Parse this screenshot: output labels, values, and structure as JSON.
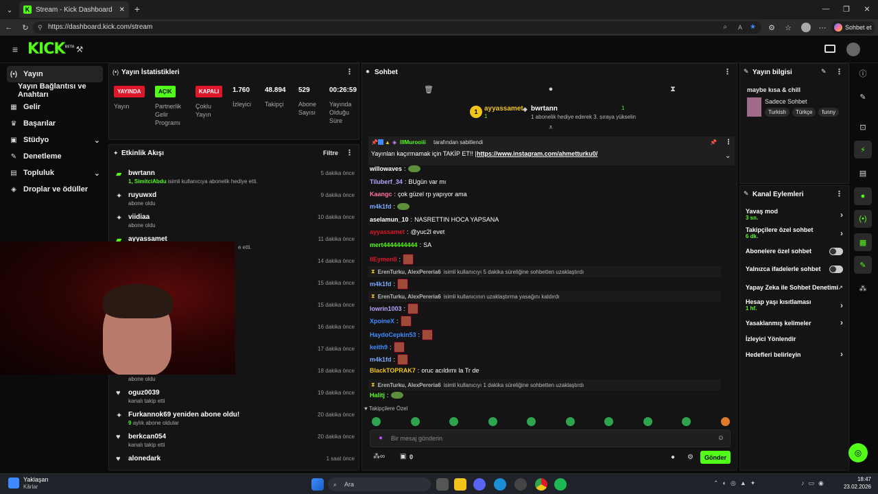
{
  "browser": {
    "tab_title": "Stream - Kick Dashboard",
    "url": "https://dashboard.kick.com/stream",
    "profile_button": "Sohbet et"
  },
  "brand": {
    "logo": "KICK",
    "beta": "BETA",
    "accent": "#53fc18"
  },
  "sidebar": {
    "items": [
      {
        "label": "Yayın",
        "icon": "broadcast-icon"
      },
      {
        "label": "Yayın Bağlantısı ve Anahtarı"
      },
      {
        "label": "Gelir",
        "icon": "revenue-icon"
      },
      {
        "label": "Başarılar",
        "icon": "trophy-icon"
      },
      {
        "label": "Stüdyo",
        "icon": "studio-icon"
      },
      {
        "label": "Denetleme",
        "icon": "wrench-icon"
      },
      {
        "label": "Topluluk",
        "icon": "community-icon"
      },
      {
        "label": "Droplar ve ödüller",
        "icon": "gift-icon"
      }
    ]
  },
  "stats": {
    "title": "Yayın İstatistikleri",
    "badges": [
      {
        "text": "YAYINDA",
        "label": "Yayın",
        "color": "#e0162b"
      },
      {
        "text": "AÇIK",
        "label": "Partnerlik Gelir Programı",
        "color": "#53fc18"
      },
      {
        "text": "KAPALI",
        "label": "Çoklu Yayın",
        "color": "#e0162b"
      }
    ],
    "values": [
      {
        "value": "1.760",
        "label": "İzleyici"
      },
      {
        "value": "48.894",
        "label": "Takipçi"
      },
      {
        "value": "529",
        "label": "Abone Sayısı"
      },
      {
        "value": "00:26:59",
        "label": "Yayında Olduğu Süre"
      }
    ]
  },
  "activity": {
    "title": "Etkinlik Akışı",
    "filter": "Filtre",
    "items": [
      {
        "name": "bwrtann",
        "sub_count": "1,",
        "sub_user": "SimitciAbdu",
        "sub": "isimli kullanıcıya abonelik hediye etti.",
        "time": "5 dakika önce",
        "icon": "gift-icon"
      },
      {
        "name": "ruyuwxd",
        "sub": "abone oldu",
        "time": "9 dakika önce",
        "icon": "sparkle-icon"
      },
      {
        "name": "viidiaa",
        "sub": "abone oldu",
        "time": "10 dakika önce",
        "icon": "sparkle-icon"
      },
      {
        "name": "ayyassamet",
        "sub": "e etti.",
        "time": "11 dakika önce",
        "icon": "gift-icon"
      },
      {
        "name": "",
        "sub": "",
        "time": "14 dakika önce"
      },
      {
        "name": "",
        "sub": "",
        "time": "15 dakika önce"
      },
      {
        "name": "",
        "sub": "",
        "time": "15 dakika önce"
      },
      {
        "name": "",
        "sub": "",
        "time": "16 dakika önce"
      },
      {
        "name": "",
        "sub": "",
        "time": "17 dakika önce"
      },
      {
        "name": "",
        "sub": "abone oldu",
        "time": "18 dakika önce"
      },
      {
        "name": "oguz0039",
        "sub": "kanalı takip etti",
        "time": "19 dakika önce",
        "icon": "heart-icon"
      },
      {
        "name": "Furkannok69 yeniden abone oldu!",
        "sub_count": "9",
        "sub": "aylık abone oldular",
        "time": "20 dakika önce",
        "icon": "sparkle-icon"
      },
      {
        "name": "berkcan054",
        "sub": "kanalı takip etti",
        "time": "20 dakika önce",
        "icon": "heart-icon"
      },
      {
        "name": "alonedark",
        "sub": "",
        "time": "1 saat önce",
        "icon": "heart-icon"
      }
    ]
  },
  "chat": {
    "title": "Sohbet",
    "gifter_left": {
      "rank": "1",
      "name": "ayyassamet",
      "count": "1"
    },
    "gifter_right": {
      "name": "bwrtann",
      "count": "1",
      "note": "1 abonelik hediye ederek 3. sıraya yükselin"
    },
    "pinned_by_user": "lllMurooiii",
    "pinned_by": "tarafından sabitlendi",
    "pinned_text": "Yayınları kaçırmamak için TAKİP ET!! |",
    "pinned_link": "https://www.instagram.com/ahmetturku0/",
    "messages": [
      {
        "user": "willowaves",
        "color": "#ffffff",
        "text": "",
        "emote": "frog"
      },
      {
        "user": "Tiluberf_34",
        "color": "#b9a3ff",
        "text": "BUgün var mı"
      },
      {
        "user": "Kaangc",
        "color": "#ff6fa3",
        "text": "çok güzel rp yapıyor ama"
      },
      {
        "user": "m4k1fd",
        "color": "#7aa7ff",
        "text": "",
        "emote": "frog"
      },
      {
        "user": "aselamun_10",
        "color": "#ffffff",
        "text": "NASRETTIN HOCA YAPSANA"
      },
      {
        "user": "ayyassamet",
        "color": "#e0162b",
        "text": "@yuc2l evet"
      },
      {
        "user": "mert4444444444",
        "color": "#53fc18",
        "text": "SA"
      },
      {
        "user": "llEymenll",
        "color": "#e0162b",
        "text": "",
        "emote": "face"
      },
      {
        "system": true,
        "users": "ErenTurku, AlexPereria6",
        "text": "isimli kullanıcıyı 5 dakika süreliğine sohbetten uzaklaştırdı"
      },
      {
        "user": "m4k1fd",
        "color": "#7aa7ff",
        "text": "",
        "emote": "face"
      },
      {
        "system": true,
        "users": "ErenTurku, AlexPereria6",
        "text": "isimli kullanıcının uzaklaştırma yasağını kaldırdı"
      },
      {
        "user": "lowrin1003",
        "color": "#b9a3ff",
        "text": "",
        "emote": "face"
      },
      {
        "user": "XpoineX",
        "color": "#3e8bff",
        "text": "",
        "emote": "face"
      },
      {
        "user": "HaydoCepkin53",
        "color": "#3e8bff",
        "text": "",
        "emote": "face"
      },
      {
        "user": "keith9",
        "color": "#3e8bff",
        "text": "",
        "emote": "face"
      },
      {
        "user": "m4k1fd",
        "color": "#7aa7ff",
        "text": "",
        "emote": "face"
      },
      {
        "user": "BlackTOPRAK7",
        "color": "#f0c419",
        "text": "oruc acıldımı la Tr de"
      },
      {
        "system": true,
        "users": "ErenTurku, AlexPereria6",
        "text": "isimli kullanıcıyı 1 dakika süreliğine sohbetten uzaklaştırdı"
      },
      {
        "user": "Halitj",
        "color": "#53fc18",
        "text": "",
        "emote": "frog"
      }
    ],
    "followers_only": "Takipçilere Özel",
    "input_placeholder": "Bir mesaj gönderin",
    "gift_count": "0",
    "send": "Gönder"
  },
  "stream_info": {
    "title": "Yayın bilgisi",
    "stream_title": "maybe kısa & chill",
    "category": "Sadece Sohbet",
    "tags": [
      "Turkish",
      "Türkçe",
      "funny"
    ]
  },
  "channel_actions": {
    "title": "Kanal Eylemleri",
    "items": [
      {
        "label": "Yavaş mod",
        "sub": "3 sn.",
        "type": "chevron"
      },
      {
        "label": "Takipçilere özel sohbet",
        "sub": "6 dk.",
        "type": "chevron"
      },
      {
        "label": "Abonelere özel sohbet",
        "type": "toggle"
      },
      {
        "label": "Yalnızca ifadelerle sohbet",
        "type": "toggle"
      },
      {
        "label": "Yapay Zeka ile Sohbet Denetimi",
        "type": "link"
      },
      {
        "label": "Hesap yaşı kısıtlaması",
        "sub": "1 hf.",
        "type": "chevron"
      },
      {
        "label": "Yasaklanmış kelimeler",
        "type": "chevron"
      },
      {
        "label": "İzleyici Yönlendir",
        "type": "none"
      },
      {
        "label": "Hedefleri belirleyin",
        "type": "chevron"
      }
    ]
  },
  "taskbar": {
    "weather_title": "Yaklaşan",
    "weather_sub": "Kârlar",
    "search": "Ara",
    "time": "18:47",
    "date": "23.02.2026"
  }
}
